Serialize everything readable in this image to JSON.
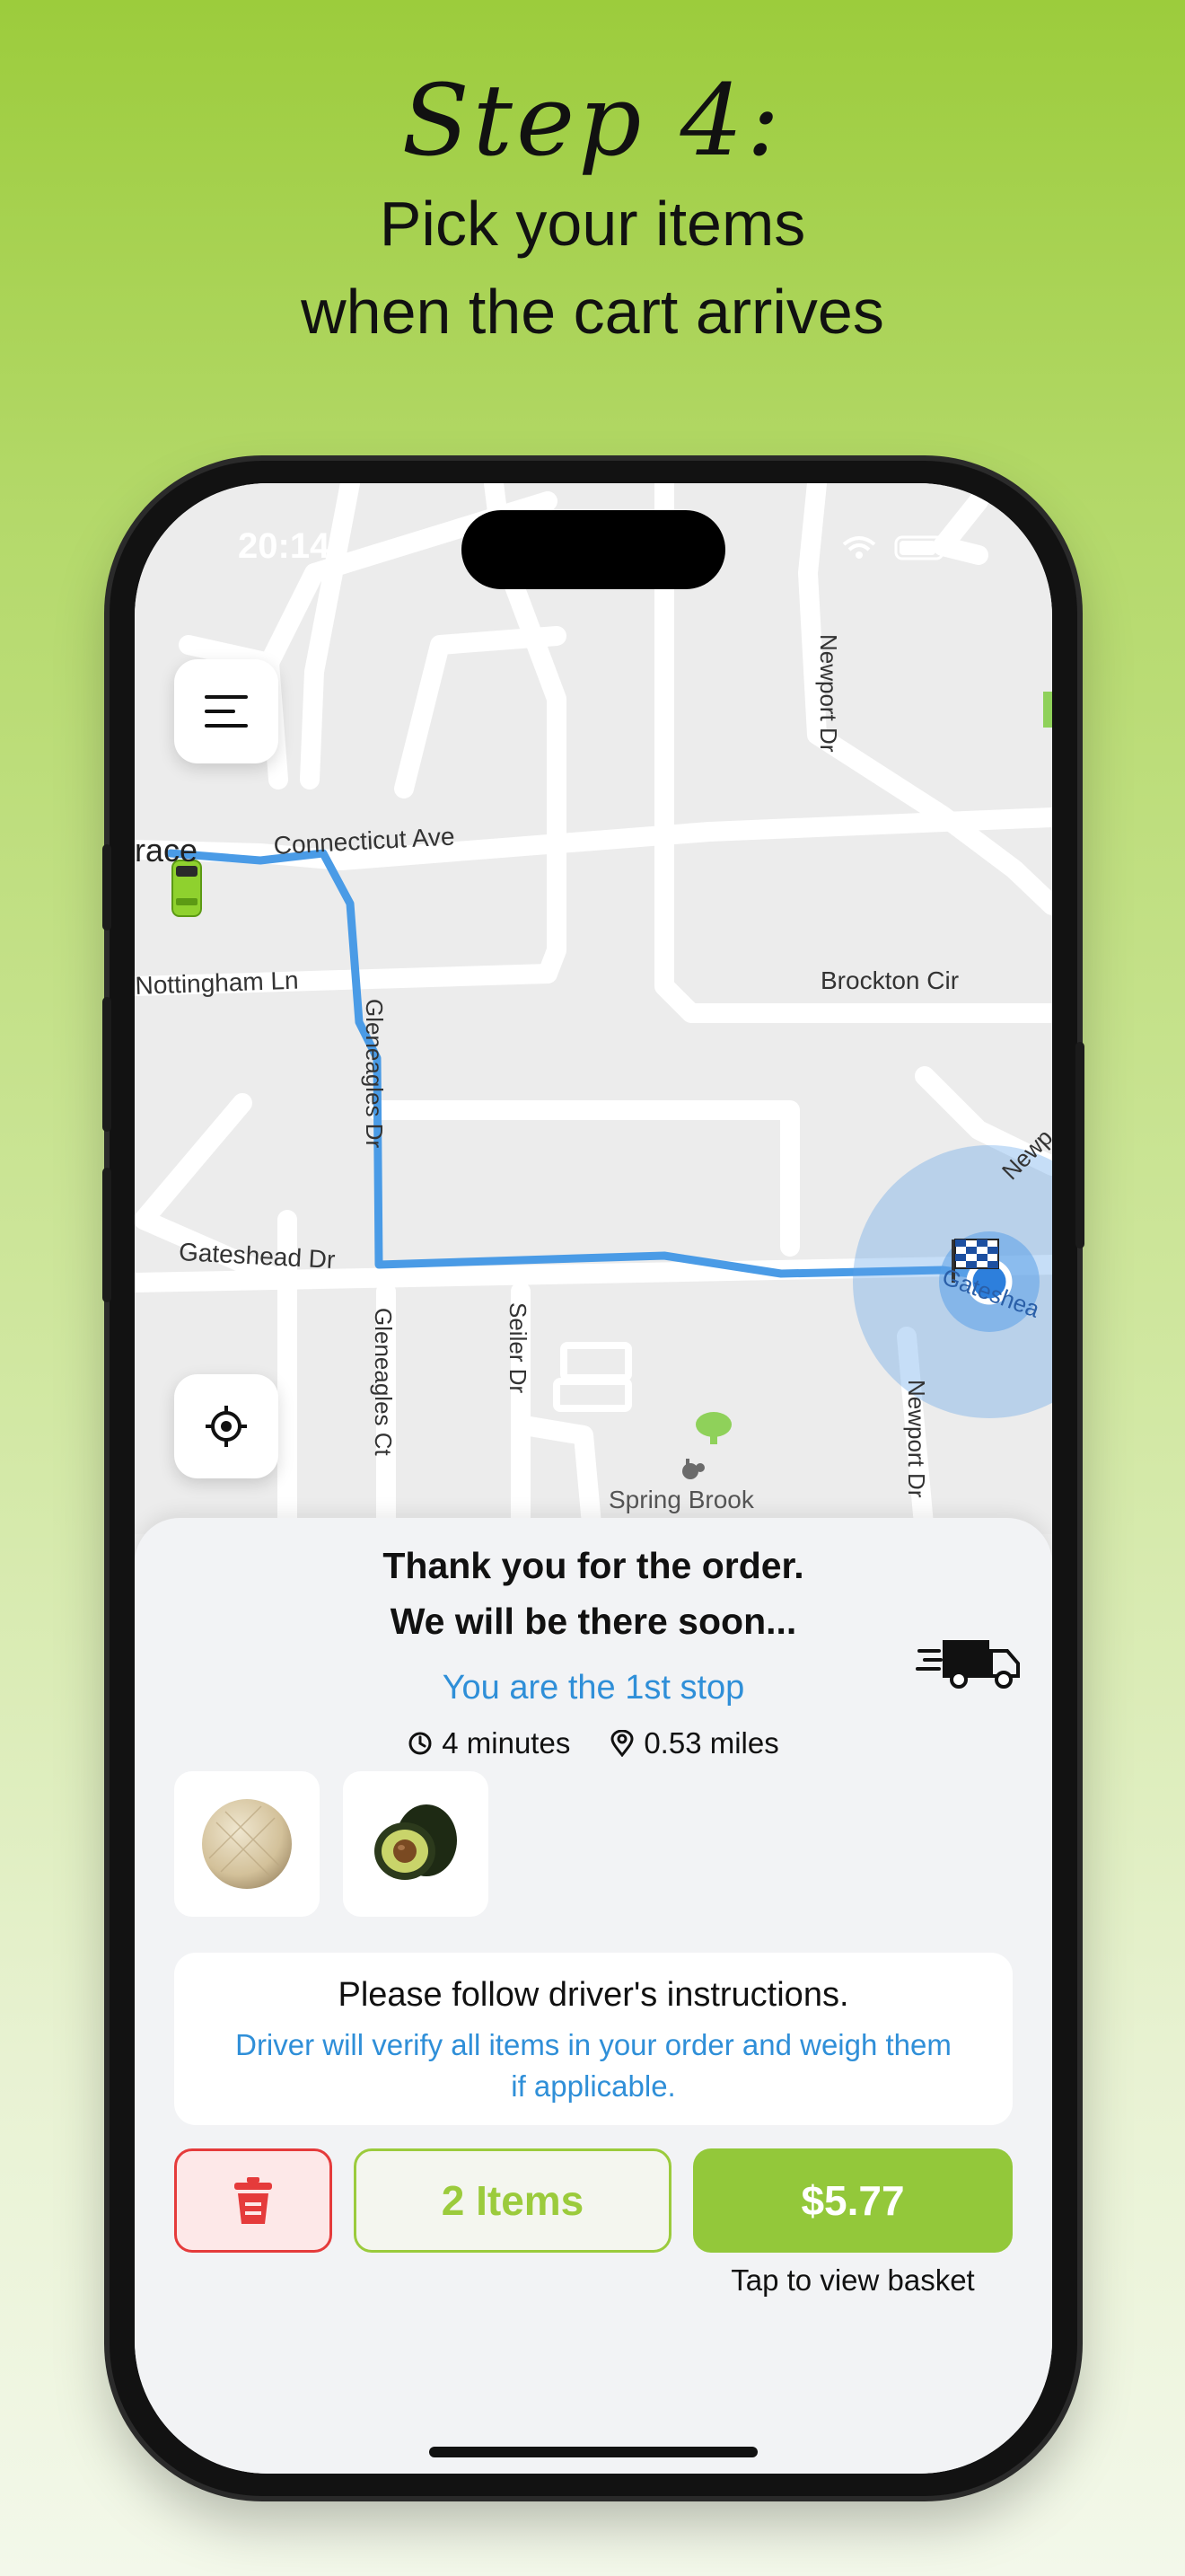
{
  "header": {
    "step": "Step 4:",
    "line1": "Pick your items",
    "line2": "when the cart arrives"
  },
  "status_bar": {
    "time": "20:14"
  },
  "map": {
    "streets": {
      "connecticut": "Connecticut Ave",
      "nottingham": "Nottingham Ln",
      "brockton": "Brockton Cir",
      "newport_top": "Newport Dr",
      "gleneagles_dr": "Gleneagles Dr",
      "gleneagles_ct": "Gleneagles Ct",
      "gateshead": "Gateshead Dr",
      "seiler": "Seiler Dr",
      "newport_bottom": "Newport Dr",
      "newport_right": "Newp",
      "gateshead_right": "Gateshea",
      "terrace": "race",
      "spring_brook": "Spring Brook"
    },
    "menu_icon": "hamburger-menu-icon",
    "locate_icon": "crosshair-locate-icon"
  },
  "order_sheet": {
    "thanks_line1": "Thank you for the order.",
    "thanks_line2": "We will be there soon...",
    "stop_text": "You are the 1st stop",
    "eta": "4 minutes",
    "distance": "0.53 miles",
    "items": [
      {
        "name": "Cantaloupe",
        "icon": "cantaloupe-image"
      },
      {
        "name": "Avocado",
        "icon": "avocado-image"
      }
    ],
    "notice_title": "Please follow driver's instructions.",
    "notice_body": "Driver will verify all items in your order and weigh them if applicable.",
    "items_button": "2 Items",
    "price_button": "$5.77",
    "tap_hint": "Tap to view basket"
  },
  "colors": {
    "brand_green": "#93c83a",
    "link_blue": "#2f8fd8",
    "route_blue": "#4a9be6",
    "danger_red": "#e53b3b"
  }
}
